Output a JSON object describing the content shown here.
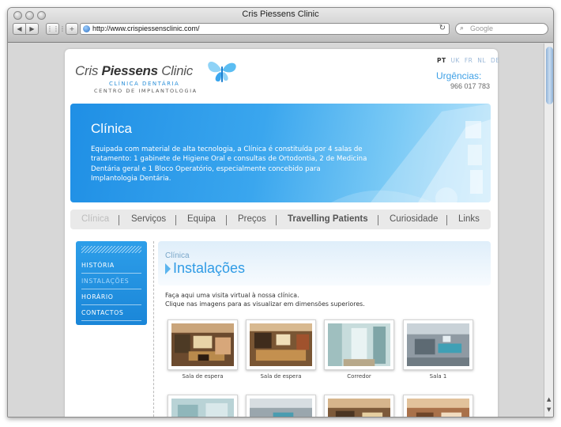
{
  "browser": {
    "window_title": "Cris Piessens Clinic",
    "url": "http://www.crispiessensclinic.com/",
    "search_placeholder": "Google"
  },
  "header": {
    "logo": {
      "name_light": "Cris ",
      "name_bold": "Piessens",
      "name_end": " Clinic",
      "line1": "CLÍNICA DENTÁRIA",
      "line2": "CENTRO DE IMPLANTOLOGIA"
    },
    "languages": [
      "PT",
      "UK",
      "FR",
      "NL",
      "DE"
    ],
    "active_language": "PT",
    "urgencies_label": "Urgências:",
    "urgencies_phone": "966 017 783"
  },
  "hero": {
    "title": "Clínica",
    "text": "Equipada com material de alta tecnologia, a Clínica é constituída por 4 salas de tratamento: 1 gabinete de Higiene Oral e consultas de Ortodontia, 2 de Medicina Dentária geral e 1 Bloco Operatório, especialmente concebido para Implantologia Dentária."
  },
  "nav": {
    "items": [
      "Clínica",
      "Serviços",
      "Equipa",
      "Preços",
      "Travelling Patients",
      "Curiosidade",
      "Links"
    ],
    "active": "Clínica"
  },
  "sidebar": {
    "items": [
      "HISTÓRIA",
      "INSTALAÇÕES",
      "HORÁRIO",
      "CONTACTOS"
    ],
    "current": "INSTALAÇÕES"
  },
  "content": {
    "breadcrumb": "Clínica",
    "title": "Instalações",
    "intro_line1": "Faça aqui uma visita virtual à nossa clínica.",
    "intro_line2": "Clique nas imagens para as visualizar em dimensões superiores."
  },
  "gallery": [
    {
      "caption": "Sala de espera"
    },
    {
      "caption": "Sala de espera"
    },
    {
      "caption": "Corredor"
    },
    {
      "caption": "Sala 1"
    },
    {
      "caption": ""
    },
    {
      "caption": ""
    },
    {
      "caption": ""
    },
    {
      "caption": ""
    }
  ],
  "colors": {
    "accent": "#2f9be5",
    "sidebar": "#1f8fe0",
    "nav_bg": "#e9e9e9"
  }
}
